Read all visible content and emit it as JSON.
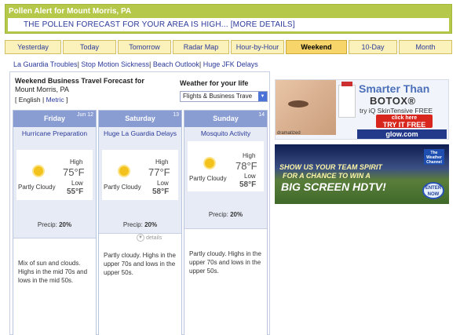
{
  "alert": {
    "title": "Pollen Alert for Mount Morris, PA",
    "message": "THE POLLEN FORECAST FOR YOUR AREA IS HIGH...",
    "more_link": "[MORE DETAILS]"
  },
  "tabs": [
    {
      "label": "Yesterday",
      "active": false
    },
    {
      "label": "Today",
      "active": false
    },
    {
      "label": "Tomorrow",
      "active": false
    },
    {
      "label": "Radar Map",
      "active": false
    },
    {
      "label": "Hour-by-Hour",
      "active": false
    },
    {
      "label": "Weekend",
      "active": true
    },
    {
      "label": "10-Day",
      "active": false
    },
    {
      "label": "Month",
      "active": false
    }
  ],
  "links": [
    "La Guardia Troubles",
    "Stop Motion Sickness",
    "Beach Outlook",
    "Huge JFK Delays"
  ],
  "forecast": {
    "title": "Weekend Business Travel Forecast for",
    "location": "Mount Morris, PA",
    "lang_english": "English",
    "lang_metric": "Metric",
    "weather_for_life_label": "Weather for your life",
    "select_value": "Flights & Business Trave"
  },
  "days": [
    {
      "name": "Friday",
      "date": "Jun 12",
      "activity": "Hurricane Preparation",
      "condition": "Partly Cloudy",
      "high_label": "High",
      "high": "75°F",
      "low_label": "Low",
      "low": "55°F",
      "precip_label": "Precip:",
      "precip": "20%",
      "description": "Mix of sun and clouds. Highs in the mid 70s and lows in the mid 50s."
    },
    {
      "name": "Saturday",
      "date": "13",
      "activity": "Huge La Guardia Delays",
      "condition": "Partly Cloudy",
      "high_label": "High",
      "high": "77°F",
      "low_label": "Low",
      "low": "58°F",
      "precip_label": "Precip:",
      "precip": "20%",
      "details": "details",
      "description": "Partly cloudy. Highs in the upper 70s and lows in the upper 50s."
    },
    {
      "name": "Sunday",
      "date": "14",
      "activity": "Mosquito Activity",
      "condition": "Partly Cloudy",
      "high_label": "High",
      "high": "78°F",
      "low_label": "Low",
      "low": "58°F",
      "precip_label": "Precip:",
      "precip": "20%",
      "description": "Partly cloudy. Highs in the upper 70s and lows in the upper 50s."
    }
  ],
  "ads": {
    "botox": {
      "line1": "Smarter Than",
      "line2": "BOTOX®",
      "line3": "try iQ SkinTensive FREE",
      "btn_small": "click here",
      "btn_big": "TRY IT FREE",
      "dramatized": "dramatized",
      "site": "glow.com"
    },
    "hdtv": {
      "line1": "SHOW US YOUR TEAM SPIRIT",
      "line2": "FOR A CHANCE TO WIN A",
      "line3": "BIG SCREEN HDTV!",
      "logo": "The Weather Channel",
      "enter": "ENTER NOW"
    }
  }
}
